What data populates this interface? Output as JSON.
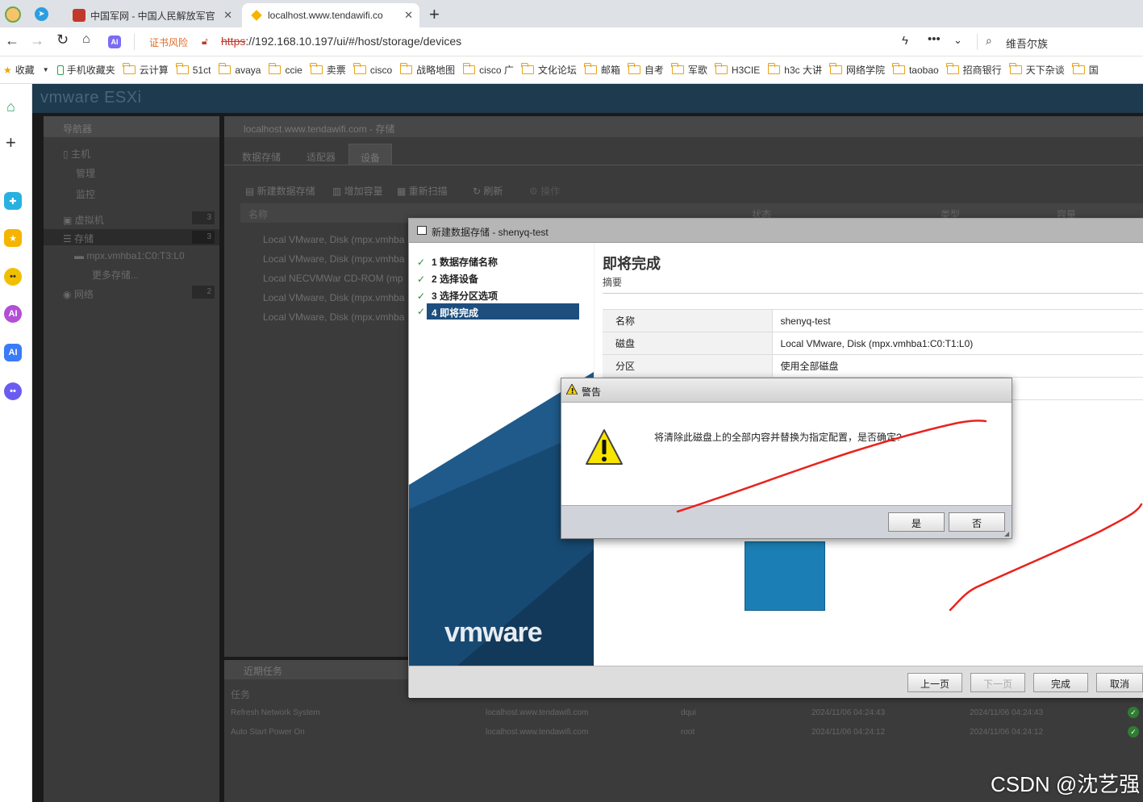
{
  "browser": {
    "tabs": [
      {
        "title": "中国军网 - 中国人民解放军官"
      },
      {
        "title": "localhost.www.tendawifi.co"
      }
    ],
    "new_tab_icon": "plus-icon",
    "cert_warning": "证书风险",
    "url_scheme": "https",
    "url_rest": "://192.168.10.197/ui/#/host/storage/devices",
    "search_text": "维吾尔族",
    "bookmarks": [
      "收藏",
      "手机收藏夹",
      "云计算",
      "51ct",
      "avaya",
      "ccie",
      "卖票",
      "cisco",
      "战略地图",
      "cisco 广",
      "文化论坛",
      "邮箱",
      "自考",
      "军歌",
      "H3CIE",
      "h3c 大讲",
      "网络学院",
      "taobao",
      "招商银行",
      "天下杂谈",
      "国"
    ]
  },
  "esxi": {
    "brand": "vmware ESXi",
    "navigator": {
      "title": "导航器",
      "host": "主机",
      "manage": "管理",
      "monitor": "监控",
      "vms": "虚拟机",
      "vms_count": "3",
      "storage": "存储",
      "storage_count": "3",
      "device": "mpx.vmhba1:C0:T3:L0",
      "more_storage": "更多存储...",
      "network": "网络",
      "network_count": "2"
    },
    "panel_title": "localhost.www.tendawifi.com - 存储",
    "tabs": [
      "数据存储",
      "适配器",
      "设备"
    ],
    "actions": [
      "新建数据存储",
      "增加容量",
      "重新扫描",
      "刷新",
      "操作"
    ],
    "columns": [
      "名称",
      "状态",
      "类型",
      "容量"
    ],
    "devices": [
      "Local VMware, Disk (mpx.vmhba",
      "Local VMware, Disk (mpx.vmhba",
      "Local NECVMWar CD-ROM (mp",
      "Local VMware, Disk (mpx.vmhba",
      "Local VMware, Disk (mpx.vmhba"
    ],
    "recent": {
      "title": "近期任务",
      "task_col": "任务",
      "rows": [
        {
          "task": "Refresh Network System",
          "target": "localhost.www.tendawifi.com",
          "user": "dqui",
          "queued": "2024/11/06 04:24:43",
          "started": "2024/11/06 04:24:43"
        },
        {
          "task": "Auto Start Power On",
          "target": "localhost.www.tendawifi.com",
          "user": "root",
          "queued": "2024/11/06 04:24:12",
          "started": "2024/11/06 04:24:12"
        }
      ]
    }
  },
  "wizard": {
    "title": "新建数据存储 - shenyq-test",
    "steps": [
      "1 数据存储名称",
      "2 选择设备",
      "3 选择分区选项",
      "4 即将完成"
    ],
    "heading": "即将完成",
    "subheading": "摘要",
    "summary": [
      {
        "label": "名称",
        "value": "shenyq-test"
      },
      {
        "label": "磁盘",
        "value": "Local VMware, Disk (mpx.vmhba1:C0:T1:L0)"
      },
      {
        "label": "分区",
        "value": "使用全部磁盘"
      }
    ],
    "logo": "vmware",
    "buttons": {
      "back": "上一页",
      "next": "下一页",
      "finish": "完成",
      "cancel": "取消"
    }
  },
  "dialog": {
    "title": "警告",
    "message": "将清除此磁盘上的全部内容并替换为指定配置，是否确定?",
    "yes": "是",
    "no": "否"
  },
  "watermark": "CSDN @沈艺强",
  "colors": {
    "annotation": "#e8231e",
    "wizard_active": "#1d4e7e",
    "esxi_header": "#1d3a4f"
  }
}
